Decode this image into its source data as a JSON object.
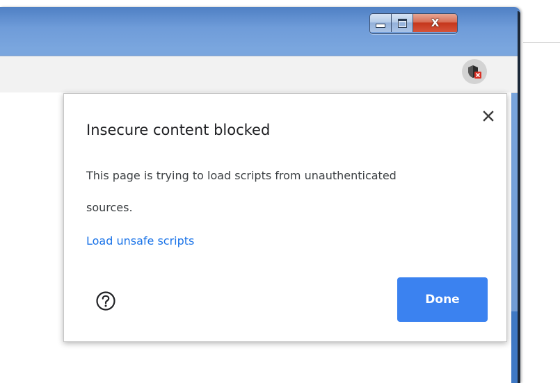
{
  "window": {
    "minimize_icon": "minimize-icon",
    "maximize_icon": "maximize-icon",
    "close_label": "X",
    "accent": "#4f80c4"
  },
  "toolbar": {
    "site_security_icon": "shield-blocked-icon",
    "badge_color": "#d93025"
  },
  "popup": {
    "title": "Insecure content blocked",
    "body": "This page is trying to load scripts from unauthenticated sources.",
    "link": "Load unsafe scripts",
    "help_icon": "help-icon",
    "close_icon": "close-icon",
    "done_label": "Done",
    "link_color": "#1a73e8",
    "button_color": "#3b82f0"
  }
}
